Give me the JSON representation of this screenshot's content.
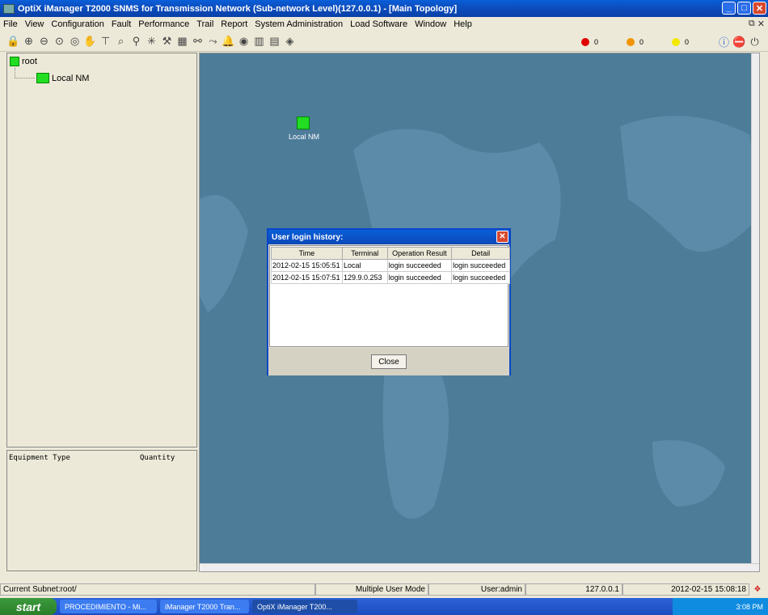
{
  "window": {
    "title": "OptiX iManager T2000 SNMS for Transmission Network (Sub-network Level)(127.0.0.1) - [Main Topology]"
  },
  "menu": [
    "File",
    "View",
    "Configuration",
    "Fault",
    "Performance",
    "Trail",
    "Report",
    "System Administration",
    "Load Software",
    "Window",
    "Help"
  ],
  "alarms": [
    {
      "count": "0",
      "color": "#e00000"
    },
    {
      "count": "0",
      "color": "#f29400"
    },
    {
      "count": "0",
      "color": "#f2e800"
    }
  ],
  "tree": {
    "root": "root",
    "child": "Local NM"
  },
  "equipment": {
    "col1": "Equipment Type",
    "col2": "Quantity"
  },
  "map": {
    "node_label": "Local NM"
  },
  "dialog": {
    "title": "User login history:",
    "columns": [
      "Time",
      "Terminal",
      "Operation Result",
      "Detail"
    ],
    "rows": [
      [
        "2012-02-15 15:05:51",
        "Local",
        "login succeeded",
        "login succeeded"
      ],
      [
        "2012-02-15 15:07:51",
        "129.9.0.253",
        "login succeeded",
        "login succeeded"
      ]
    ],
    "close_label": "Close"
  },
  "status": {
    "subnet": "Current Subnet:root/",
    "mode": "Multiple User Mode",
    "user": "User:admin",
    "ip": "127.0.0.1",
    "datetime": "2012-02-15 15:08:18"
  },
  "taskbar": {
    "start": "start",
    "tasks": [
      "PROCEDIMIENTO - Mi...",
      "iManager T2000 Tran...",
      "OptiX iManager T200..."
    ],
    "time": "3:08 PM"
  }
}
